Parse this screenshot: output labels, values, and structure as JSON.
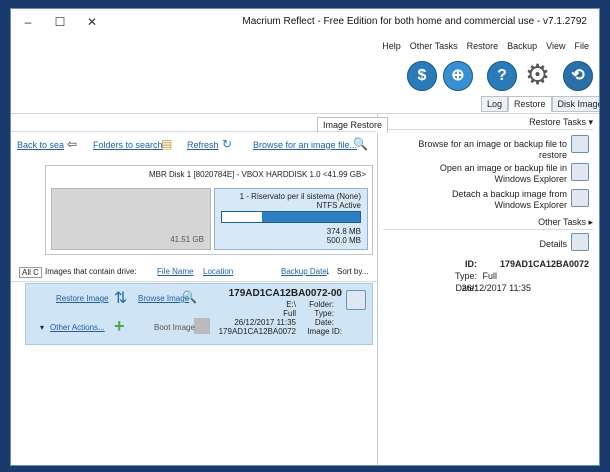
{
  "window": {
    "title": "Macrium Reflect - Free Edition for both home and commercial use - v7.1.2792",
    "minimize": "–",
    "maximize": "☐",
    "close": "✕"
  },
  "menu": [
    "File",
    "View",
    "Backup",
    "Restore",
    "Other Tasks",
    "Help"
  ],
  "tabs": [
    {
      "label": "Disk Image"
    },
    {
      "label": "Restore"
    },
    {
      "label": "Log"
    }
  ],
  "sidebar": {
    "restore_tasks": "Restore Tasks",
    "tasks": [
      {
        "label": "Browse for an image or backup file to restore"
      },
      {
        "label": "Open an image or backup file in Windows Explorer"
      },
      {
        "label": "Detach a backup image from Windows Explorer"
      }
    ],
    "other_tasks": "Other Tasks",
    "details": "Details",
    "detail_id_label": "ID:",
    "detail_id": "179AD1CA12BA0072",
    "detail_type_label": "Type:",
    "detail_type": "Full",
    "detail_date_label": "Date:",
    "detail_date": "26/12/2017 11:35"
  },
  "main": {
    "tab_label": "Image Restore",
    "toolbar": {
      "browse": "Browse for an image file...",
      "refresh": "Refresh",
      "folders": "Folders to search",
      "back": "Back to sea"
    },
    "disk": {
      "header": "MBR Disk 1 [8020784E] - VBOX HARDDISK 1.0  <41.99 GB>",
      "part_label": "1 - Riservato per il sistema (None)",
      "part_fs": "NTFS Active",
      "part_used": "374.8 MB",
      "part_total": "500.0 MB",
      "gray_size": "41.51 GB"
    },
    "sortbar": {
      "sort_by": "Sort by...",
      "backup_date": "Backup Date",
      "location": "Location",
      "file_name": "File Name",
      "images_text": "Images that contain drive:",
      "drive_label": "All C"
    },
    "image": {
      "name": "179AD1CA12BA0072-00",
      "folder_label": "Folder:",
      "folder_value": "E:\\",
      "type_label": "Type:",
      "type_value": "Full",
      "date_label": "Date:",
      "date_value": "26/12/2017 11:35",
      "id_label": "Image ID:",
      "id_value": "179AD1CA12BA0072",
      "restore_image": "Restore Image",
      "browse_image": "Browse Image",
      "boot_image": "Boot Image",
      "other_actions": "Other Actions..."
    }
  }
}
